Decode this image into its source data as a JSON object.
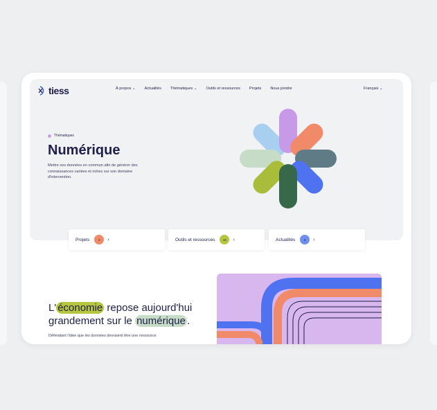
{
  "header": {
    "logo_text": "tiess",
    "nav": [
      "À propos",
      "Actualités",
      "Thématiques",
      "Outils et ressources",
      "Projets",
      "Nous joindre"
    ],
    "language": "Français"
  },
  "hero": {
    "tag": "Thématiques",
    "title": "Numérique",
    "description": "Mettre ses données en commun afin de générer des connaissances variées et riches sur son domaine d'intervention."
  },
  "tiles": [
    {
      "label": "Projets",
      "count": "3",
      "badge_color": "#f08a68"
    },
    {
      "label": "Outils et ressources",
      "count": "15",
      "badge_color": "#b6c73f"
    },
    {
      "label": "Actualités",
      "count": "8",
      "badge_color": "#6f8ff0"
    }
  ],
  "section": {
    "headline_pre": "L'",
    "headline_hl1": "économie",
    "headline_mid": " repose aujourd'hui grandement sur le ",
    "headline_hl2": "numérique",
    "headline_post": ".",
    "subtext": "Défendant l'idée que les données devraient être une ressource"
  },
  "colors": {
    "petal_purple": "#c79ae8",
    "petal_orange": "#f08a68",
    "petal_slate": "#5f7b86",
    "petal_blue": "#4f72f0",
    "petal_green": "#366849",
    "petal_olive": "#a9bd3a",
    "petal_mint": "#c7dcc6",
    "petal_sky": "#a8cfef"
  },
  "icons": {
    "chevron": "chevron-right-icon",
    "dropdown": "chevron-down-icon"
  }
}
